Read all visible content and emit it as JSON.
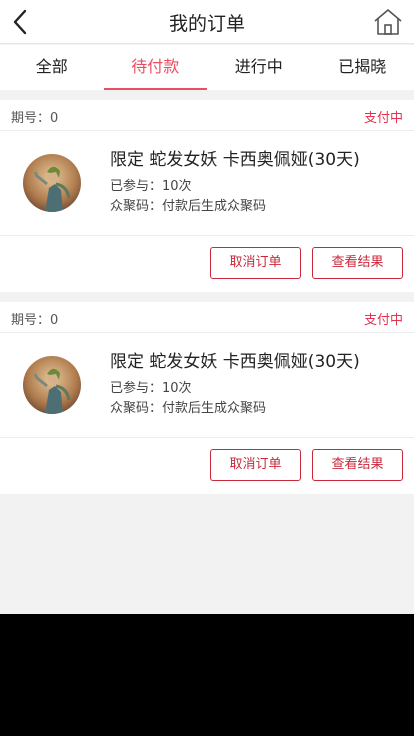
{
  "header": {
    "title": "我的订单",
    "back_icon": "chevron-left-icon",
    "home_icon": "home-icon"
  },
  "tabs": [
    {
      "label": "全部",
      "active": false
    },
    {
      "label": "待付款",
      "active": true
    },
    {
      "label": "进行中",
      "active": false
    },
    {
      "label": "已揭晓",
      "active": false
    }
  ],
  "orders": [
    {
      "period": "期号：0",
      "status": "支付中",
      "name": "限定 蛇发女妖 卡西奥佩娅(30天)",
      "joined": "已参与：10次",
      "code": "众聚码：付款后生成众聚码",
      "cancel_label": "取消订单",
      "result_label": "查看结果"
    },
    {
      "period": "期号：0",
      "status": "支付中",
      "name": "限定 蛇发女妖 卡西奥佩娅(30天)",
      "joined": "已参与：10次",
      "code": "众聚码：付款后生成众聚码",
      "cancel_label": "取消订单",
      "result_label": "查看结果"
    }
  ],
  "colors": {
    "accent": "#e94f63",
    "status": "#e8304f",
    "button": "#c9283b"
  }
}
